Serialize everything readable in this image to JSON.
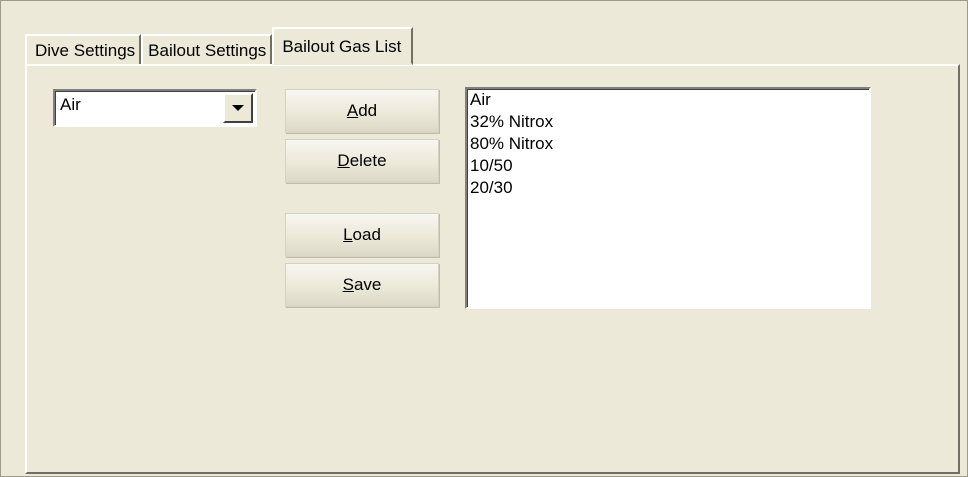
{
  "tabs": [
    {
      "label": "Dive Settings",
      "active": false
    },
    {
      "label": "Bailout Settings",
      "active": false
    },
    {
      "label": "Bailout Gas List",
      "active": true
    }
  ],
  "gas_select": {
    "value": "Air"
  },
  "buttons": {
    "add": {
      "accel": "A",
      "rest": "dd"
    },
    "delete": {
      "accel": "D",
      "rest": "elete"
    },
    "load": {
      "accel": "L",
      "rest": "oad"
    },
    "save": {
      "accel": "S",
      "rest": "ave"
    }
  },
  "gas_list": {
    "items": [
      "Air",
      "32% Nitrox",
      "80% Nitrox",
      "10/50",
      "20/30"
    ]
  }
}
